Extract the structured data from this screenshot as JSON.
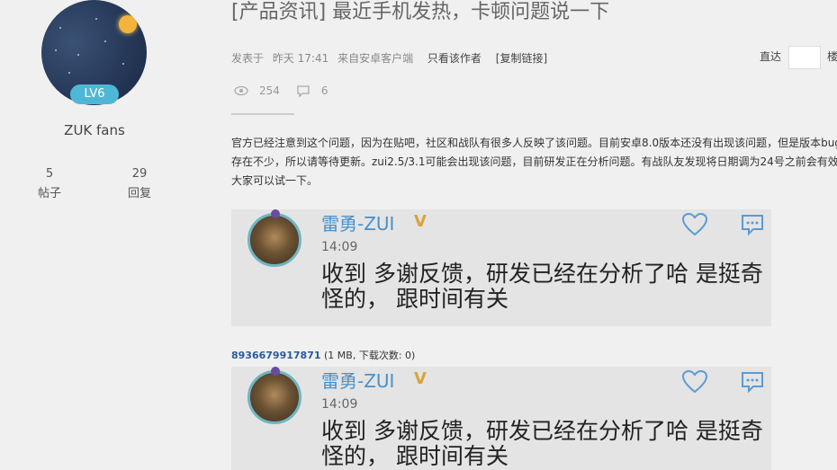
{
  "profile": {
    "level": "LV6",
    "username": "ZUK fans",
    "posts_count": "5",
    "posts_label": "帖子",
    "replies_count": "29",
    "replies_label": "回复"
  },
  "post": {
    "title": "[产品资讯] 最近手机发热，卡顿问题说一下",
    "posted_prefix": "发表于",
    "posted_time": "昨天 17:41",
    "posted_from": "来自安卓客户端",
    "only_author": "只看该作者",
    "copy_link": "[复制链接]",
    "views": "254",
    "replies": "6",
    "body": "官方已经注意到这个问题，因为在贴吧，社区和战队有很多人反映了该问题。目前安卓8.0版本还没有出现该问题，但是版本bug还存在不少，所以请等待更新。zui2.5/3.1可能会出现该问题，目前研发正在分析问题。有战队友发现将日期调为24号之前会有效，大家可以试一下。"
  },
  "jump": {
    "label": "直达",
    "floor_label": "楼"
  },
  "cards": [
    {
      "name": "雷勇-ZUI",
      "time": "14:09",
      "message": "收到  多谢反馈，研发已经在分析了哈  是挺奇怪的，   跟时间有关"
    },
    {
      "name": "雷勇-ZUI",
      "time": "14:09",
      "message": "收到  多谢反馈，研发已经在分析了哈  是挺奇怪的，   跟时间有关"
    }
  ],
  "attachment": {
    "filename": "8936679917871",
    "info": "(1 MB, 下载次数: 0)"
  },
  "icons": {
    "views": "eye-icon",
    "replies": "comment-icon",
    "like": "heart-icon",
    "comment": "chat-bubble-icon",
    "vip": "v-badge-icon"
  },
  "colors": {
    "level_badge": "#4fb7d6",
    "card_name": "#4a90c8",
    "attachment_link": "#2a5a9c"
  }
}
